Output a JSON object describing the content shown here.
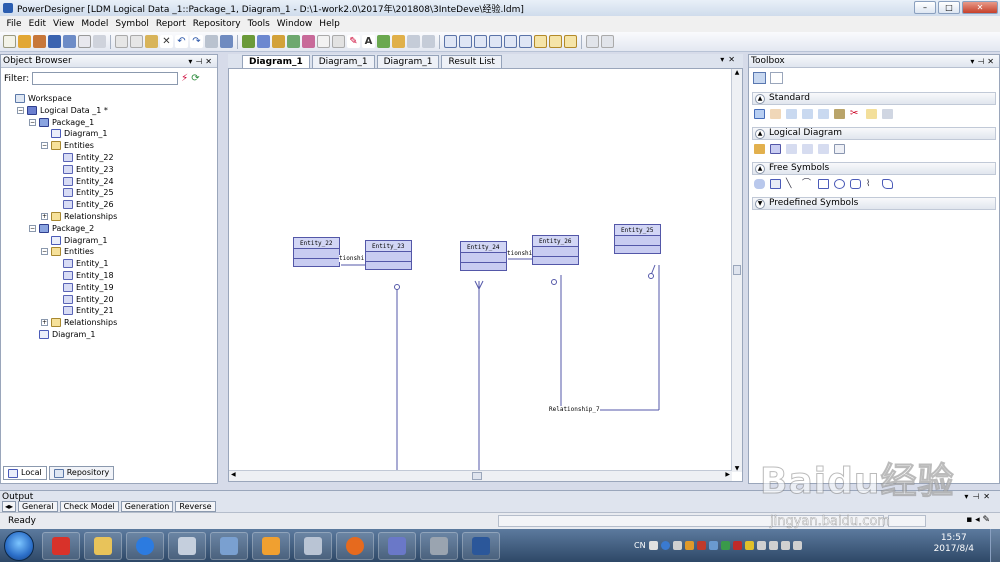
{
  "window": {
    "title": "PowerDesigner [LDM Logical Data _1::Package_1, Diagram_1 - D:\\1-work2.0\\2017年\\201808\\3InteDeve\\经验.ldm]"
  },
  "menu": [
    "File",
    "Edit",
    "View",
    "Model",
    "Symbol",
    "Report",
    "Repository",
    "Tools",
    "Window",
    "Help"
  ],
  "object_browser": {
    "title": "Object Browser",
    "filter_label": "Filter:",
    "filter_value": "",
    "tree": [
      {
        "label": "Workspace",
        "level": 0,
        "icon": "workspace-icon"
      },
      {
        "label": "Logical Data _1 *",
        "level": 1,
        "icon": "model-icon",
        "exp": "-"
      },
      {
        "label": "Package_1",
        "level": 2,
        "icon": "package-icon",
        "exp": "-"
      },
      {
        "label": "Diagram_1",
        "level": 3,
        "icon": "diagram-icon"
      },
      {
        "label": "Entities",
        "level": 3,
        "icon": "folder-icon",
        "exp": "-"
      },
      {
        "label": "Entity_22",
        "level": 4,
        "icon": "entity-icon"
      },
      {
        "label": "Entity_23",
        "level": 4,
        "icon": "entity-icon"
      },
      {
        "label": "Entity_24",
        "level": 4,
        "icon": "entity-icon"
      },
      {
        "label": "Entity_25",
        "level": 4,
        "icon": "entity-icon"
      },
      {
        "label": "Entity_26",
        "level": 4,
        "icon": "entity-icon"
      },
      {
        "label": "Relationships",
        "level": 3,
        "icon": "folder-icon",
        "exp": "+"
      },
      {
        "label": "Package_2",
        "level": 2,
        "icon": "package-icon",
        "exp": "-"
      },
      {
        "label": "Diagram_1",
        "level": 3,
        "icon": "diagram-icon"
      },
      {
        "label": "Entities",
        "level": 3,
        "icon": "folder-icon",
        "exp": "-"
      },
      {
        "label": "Entity_1",
        "level": 4,
        "icon": "entity-icon"
      },
      {
        "label": "Entity_18",
        "level": 4,
        "icon": "entity-icon"
      },
      {
        "label": "Entity_19",
        "level": 4,
        "icon": "entity-icon"
      },
      {
        "label": "Entity_20",
        "level": 4,
        "icon": "entity-icon"
      },
      {
        "label": "Entity_21",
        "level": 4,
        "icon": "entity-icon"
      },
      {
        "label": "Relationships",
        "level": 3,
        "icon": "folder-icon",
        "exp": "+"
      },
      {
        "label": "Diagram_1",
        "level": 2,
        "icon": "diagram-icon"
      }
    ],
    "tabs": [
      "Local",
      "Repository"
    ]
  },
  "doc_tabs": [
    {
      "label": "Diagram_1",
      "active": true
    },
    {
      "label": "Diagram_1",
      "active": false
    },
    {
      "label": "Diagram_1",
      "active": false
    },
    {
      "label": "Result List",
      "active": false
    }
  ],
  "diagram": {
    "entities": [
      "Entity_22",
      "Entity_23",
      "Entity_24",
      "Entity_26",
      "Entity_25"
    ],
    "relationship_labels": [
      "tionshi",
      "tionshi",
      "Relationship_7"
    ]
  },
  "toolbox": {
    "title": "Toolbox",
    "sections": [
      "Standard",
      "Logical Diagram",
      "Free Symbols",
      "Predefined Symbols"
    ]
  },
  "output": {
    "title": "Output",
    "tabs": [
      "General",
      "Check Model",
      "Generation",
      "Reverse"
    ]
  },
  "status": {
    "text": "Ready"
  },
  "taskbar": {
    "lang": "CN",
    "time": "15:57",
    "date": "2017/8/4"
  },
  "watermark": {
    "logo": "Baidu经验",
    "url": "jingyan.baidu.com"
  }
}
